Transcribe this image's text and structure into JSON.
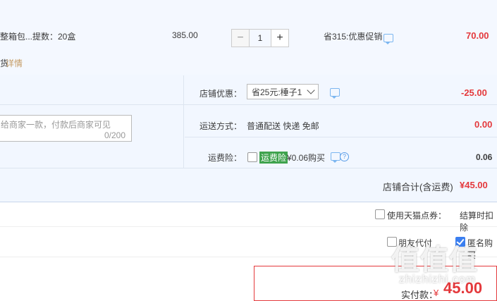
{
  "item": {
    "name_fragment": "整箱包...",
    "spec": "提数：20盒",
    "unit_price": "385.00",
    "quantity": "1",
    "minus": "−",
    "plus": "+",
    "promo": "省315:优惠促销",
    "subtotal": "70.00",
    "service_fragment": "货",
    "detail_link": "详情"
  },
  "shop": {
    "discount_label": "店铺优惠：",
    "discount_select": "省25元:棰子1",
    "discount_value": "-25.00",
    "shipping_label": "运送方式：",
    "shipping_text": "普通配送 快递 免邮",
    "shipping_value": "0.00",
    "insurance_label": "运费险：",
    "insurance_tag": "运费险",
    "insurance_text": "¥0.06购买",
    "insurance_value": "0.06",
    "message_placeholder": "给商家一款，付款后商家可见",
    "message_count": "0/200",
    "total_label": "店铺合计(含运费)",
    "total_value": "¥45.00"
  },
  "options": {
    "coupon_label": "使用天猫点券：",
    "coupon_right": "结算时扣除",
    "friend_pay": "朋友代付",
    "anonymous": "匿名购买"
  },
  "payment": {
    "label": "实付款：",
    "currency": "¥",
    "amount": "45.00"
  },
  "watermark": {
    "main": "值值值",
    "sub": "zhizhizhi.com"
  },
  "colors": {
    "accent": "#e4393c",
    "band": "#f4f8ff",
    "link": "#5a9de8"
  }
}
